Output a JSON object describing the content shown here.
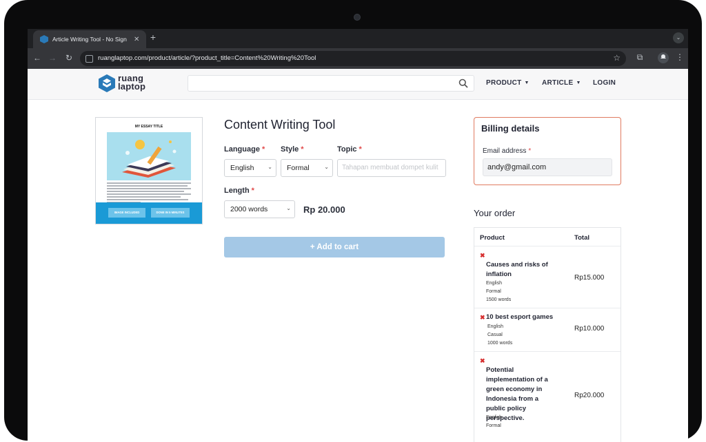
{
  "browser": {
    "tab_title": "Article Writing Tool - No Sign",
    "tab_close": "✕",
    "new_tab": "+",
    "url": "ruanglaptop.com/product/article/?product_title=Content%20Writing%20Tool"
  },
  "site": {
    "logo_line1": "ruang",
    "logo_line2": "laptop",
    "search_placeholder": "",
    "nav": [
      {
        "label": "PRODUCT"
      },
      {
        "label": "ARTICLE"
      },
      {
        "label": "LOGIN"
      }
    ]
  },
  "product": {
    "image": {
      "essay_title": "MY ESSAY TITLE",
      "badge_left": "IMAGE INCLUDED",
      "badge_right": "DONE IN 5 MINUTES"
    },
    "title": "Content Writing Tool",
    "language": {
      "label": "Language",
      "value": "English"
    },
    "style": {
      "label": "Style",
      "value": "Formal"
    },
    "topic": {
      "label": "Topic",
      "placeholder": "Tahapan membuat dompet kulit"
    },
    "length": {
      "label": "Length",
      "value": "2000 words"
    },
    "required_mark": "*",
    "price": "Rp 20.000",
    "add_to_cart": "+ Add to cart"
  },
  "billing": {
    "title": "Billing details",
    "email_label": "Email address",
    "email_value": "andy@gmail.com"
  },
  "order": {
    "title": "Your order",
    "col_product": "Product",
    "col_total": "Total",
    "remove_glyph": "✖",
    "items": [
      {
        "name": "Causes and risks of inflation",
        "language": "English",
        "style": "Formal",
        "length": "1500 words",
        "total": "Rp15.000"
      },
      {
        "name": "10 best esport games",
        "language": "English",
        "style": "Casual",
        "length": "1000 words",
        "total": "Rp10.000"
      },
      {
        "name": "Potential implementation of a green economy in Indonesia from a public policy perspective.",
        "language": "English",
        "style": "Formal",
        "length": "",
        "total": "Rp20.000"
      }
    ]
  },
  "colors": {
    "accent_blue": "#1a9ad6",
    "button_disabled": "#a4c8e6",
    "billing_border": "#e07a5f",
    "required": "#e04848",
    "remove": "#d62e2e"
  }
}
